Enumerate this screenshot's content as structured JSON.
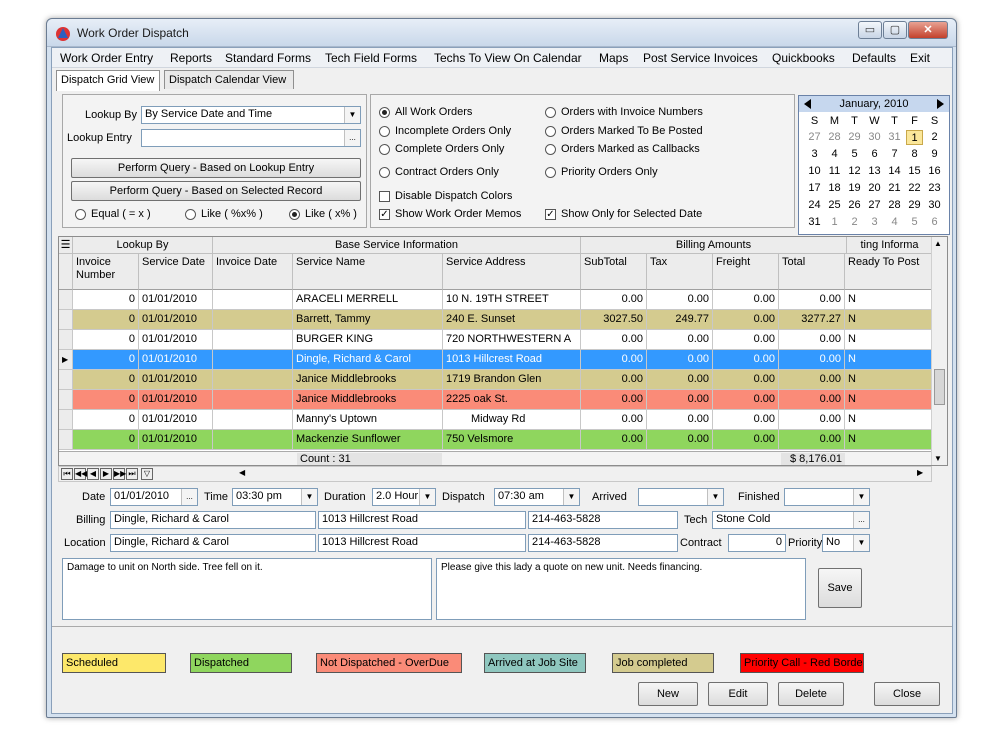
{
  "window": {
    "title": "Work Order Dispatch",
    "min_glyph": "▭",
    "max_glyph": "▢",
    "close_glyph": "✕"
  },
  "menu": [
    "Work Order Entry",
    "Reports",
    "Standard Forms",
    "Tech Field Forms",
    "Techs To View On Calendar",
    "Maps",
    "Post Service Invoices",
    "Quickbooks",
    "Defaults",
    "Exit"
  ],
  "tabs": [
    {
      "label": "Dispatch Grid View",
      "active": true
    },
    {
      "label": "Dispatch Calendar View",
      "active": false
    }
  ],
  "lookup": {
    "by_label": "Lookup By",
    "by_value": "By Service Date and Time",
    "entry_label": "Lookup Entry",
    "entry_value": "",
    "ellipsis": "...",
    "btn_query_entry": "Perform Query - Based on Lookup Entry",
    "btn_query_record": "Perform Query - Based on Selected Record",
    "match_options": [
      {
        "label": "Equal ( = x )",
        "checked": false
      },
      {
        "label": "Like ( %x% )",
        "checked": false
      },
      {
        "label": "Like ( x% )",
        "checked": true
      }
    ]
  },
  "filters": {
    "left": [
      {
        "label": "All Work Orders",
        "checked": true
      },
      {
        "label": "Incomplete Orders Only",
        "checked": false
      },
      {
        "label": "Complete Orders Only",
        "checked": false
      },
      {
        "label": "Contract Orders Only",
        "checked": false
      }
    ],
    "right": [
      {
        "label": "Orders with Invoice Numbers",
        "checked": false
      },
      {
        "label": "Orders Marked To Be Posted",
        "checked": false
      },
      {
        "label": "Orders Marked as Callbacks",
        "checked": false
      },
      {
        "label": "Priority Orders Only",
        "checked": false
      }
    ],
    "disable_colors": {
      "label": "Disable Dispatch Colors",
      "checked": false
    },
    "show_memos": {
      "label": "Show Work Order Memos",
      "checked": true
    },
    "show_selected_date": {
      "label": "Show Only for Selected Date",
      "checked": true
    }
  },
  "calendar": {
    "month": "January, 2010",
    "weekdays": [
      "S",
      "M",
      "T",
      "W",
      "T",
      "F",
      "S"
    ],
    "weeks": [
      [
        "27",
        "28",
        "29",
        "30",
        "31",
        "1",
        "2"
      ],
      [
        "3",
        "4",
        "5",
        "6",
        "7",
        "8",
        "9"
      ],
      [
        "10",
        "11",
        "12",
        "13",
        "14",
        "15",
        "16"
      ],
      [
        "17",
        "18",
        "19",
        "20",
        "21",
        "22",
        "23"
      ],
      [
        "24",
        "25",
        "26",
        "27",
        "28",
        "29",
        "30"
      ],
      [
        "31",
        "1",
        "2",
        "3",
        "4",
        "5",
        "6"
      ]
    ],
    "selected": "1"
  },
  "grid": {
    "groups": [
      {
        "label": "Lookup By"
      },
      {
        "label": "Base Service Information"
      },
      {
        "label": "Billing Amounts"
      },
      {
        "label": "ting Informa"
      }
    ],
    "columns": [
      "Invoice Number",
      "Service Date",
      "Invoice Date",
      "Service Name",
      "Service Address",
      "SubTotal",
      "Tax",
      "Freight",
      "Total",
      "Ready To Post"
    ],
    "rows": [
      {
        "inv": "0",
        "date": "01/01/2010",
        "idate": "",
        "name": "ARACELI MERRELL",
        "addr": "10 N. 19TH STREET",
        "sub": "0.00",
        "tax": "0.00",
        "frt": "0.00",
        "tot": "0.00",
        "post": "N",
        "color": "#ffffff"
      },
      {
        "inv": "0",
        "date": "01/01/2010",
        "idate": "",
        "name": "Barrett, Tammy",
        "addr": "240 E. Sunset",
        "sub": "3027.50",
        "tax": "249.77",
        "frt": "0.00",
        "tot": "3277.27",
        "post": "N",
        "color": "#d4cb8f"
      },
      {
        "inv": "0",
        "date": "01/01/2010",
        "idate": "",
        "name": "BURGER KING",
        "addr": "720 NORTHWESTERN A",
        "sub": "0.00",
        "tax": "0.00",
        "frt": "0.00",
        "tot": "0.00",
        "post": "N",
        "color": "#ffffff"
      },
      {
        "inv": "0",
        "date": "01/01/2010",
        "idate": "",
        "name": "Dingle, Richard & Carol",
        "addr": "1013 Hillcrest Road",
        "sub": "0.00",
        "tax": "0.00",
        "frt": "0.00",
        "tot": "0.00",
        "post": "N",
        "color": "#3399ff",
        "selected": true
      },
      {
        "inv": "0",
        "date": "01/01/2010",
        "idate": "",
        "name": "Janice Middlebrooks",
        "addr": "1719 Brandon Glen",
        "sub": "0.00",
        "tax": "0.00",
        "frt": "0.00",
        "tot": "0.00",
        "post": "N",
        "color": "#d4cb8f"
      },
      {
        "inv": "0",
        "date": "01/01/2010",
        "idate": "",
        "name": "Janice Middlebrooks",
        "addr": "2225 oak St.",
        "sub": "0.00",
        "tax": "0.00",
        "frt": "0.00",
        "tot": "0.00",
        "post": "N",
        "color": "#fa8b78"
      },
      {
        "inv": "0",
        "date": "01/01/2010",
        "idate": "",
        "name": "Manny's Uptown",
        "addr": "Midway Rd",
        "sub": "0.00",
        "tax": "0.00",
        "frt": "0.00",
        "tot": "0.00",
        "post": "N",
        "color": "#ffffff"
      },
      {
        "inv": "0",
        "date": "01/01/2010",
        "idate": "",
        "name": "Mackenzie Sunflower",
        "addr": "750 Velsmore",
        "sub": "0.00",
        "tax": "0.00",
        "frt": "0.00",
        "tot": "0.00",
        "post": "N",
        "color": "#8fd65e"
      }
    ],
    "count": "Count : 31",
    "total": "$ 8,176.01"
  },
  "detail": {
    "date_label": "Date",
    "date": "01/01/2010",
    "time_label": "Time",
    "time": "03:30 pm",
    "duration_label": "Duration",
    "duration": "2.0 Hour",
    "dispatch_label": "Dispatch",
    "dispatch": "07:30 am",
    "arrived_label": "Arrived",
    "arrived": "",
    "finished_label": "Finished",
    "finished": "",
    "billing_label": "Billing",
    "billing_name": "Dingle, Richard & Carol",
    "billing_addr": "1013 Hillcrest Road",
    "billing_phone": "214-463-5828",
    "tech_label": "Tech",
    "tech": "Stone Cold",
    "location_label": "Location",
    "loc_name": "Dingle, Richard & Carol",
    "loc_addr": "1013 Hillcrest Road",
    "loc_phone": "214-463-5828",
    "contract_label": "Contract",
    "contract": "0",
    "priority_label": "Priority",
    "priority": "No",
    "memo1": "Damage to unit on North side.  Tree fell on it.",
    "memo2": "Please give this lady a quote on new unit.  Needs financing.",
    "save": "Save"
  },
  "legend": [
    {
      "label": "Scheduled",
      "color": "#fde86a"
    },
    {
      "label": "Dispatched",
      "color": "#8fd65e"
    },
    {
      "label": "Not Dispatched - OverDue",
      "color": "#fa8b78"
    },
    {
      "label": "Arrived at Job Site",
      "color": "#8fc7bf"
    },
    {
      "label": "Job completed",
      "color": "#d4cb8f"
    },
    {
      "label": "Priority Call - Red Border",
      "color": "#ff0000"
    }
  ],
  "buttons": {
    "new": "New",
    "edit": "Edit",
    "delete": "Delete",
    "close": "Close"
  }
}
